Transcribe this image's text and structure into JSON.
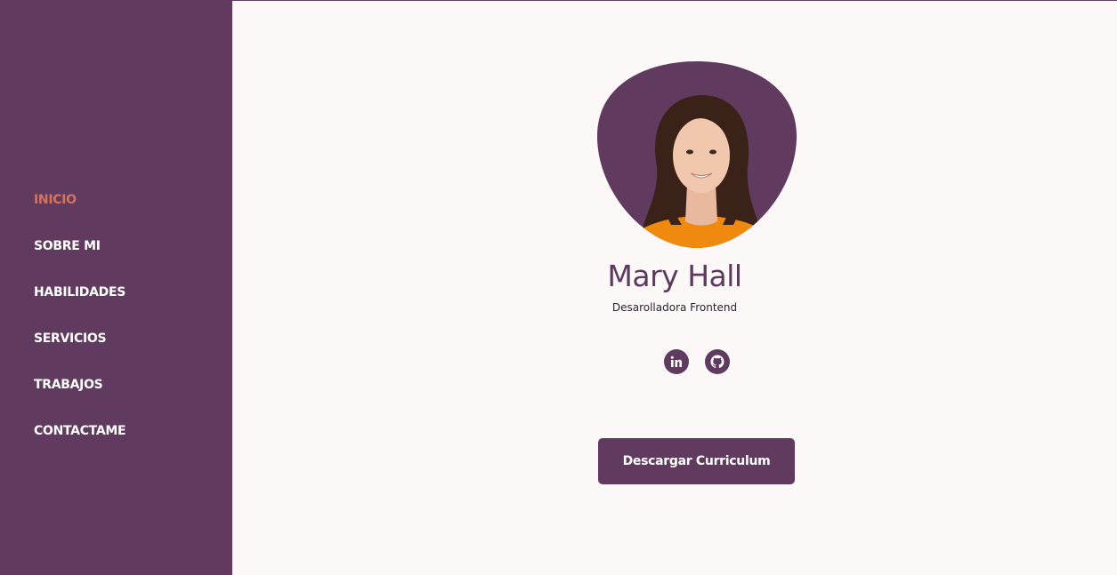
{
  "nav": {
    "items": [
      {
        "label": "INICIO",
        "active": true
      },
      {
        "label": "SOBRE MI",
        "active": false
      },
      {
        "label": "HABILIDADES",
        "active": false
      },
      {
        "label": "SERVICIOS",
        "active": false
      },
      {
        "label": "TRABAJOS",
        "active": false
      },
      {
        "label": "CONTACTAME",
        "active": false
      }
    ]
  },
  "profile": {
    "name": "Mary Hall",
    "role": "Desarolladora Frontend"
  },
  "socials": [
    {
      "icon": "linkedin-icon"
    },
    {
      "icon": "github-icon"
    }
  ],
  "cta": {
    "label": "Descargar Curriculum"
  },
  "colors": {
    "sidebar_bg": "#613a5f",
    "active_nav": "#d4745e",
    "page_bg": "#fdf8f8",
    "accent": "#5c3a5e",
    "shirt": "#f08a0f"
  }
}
